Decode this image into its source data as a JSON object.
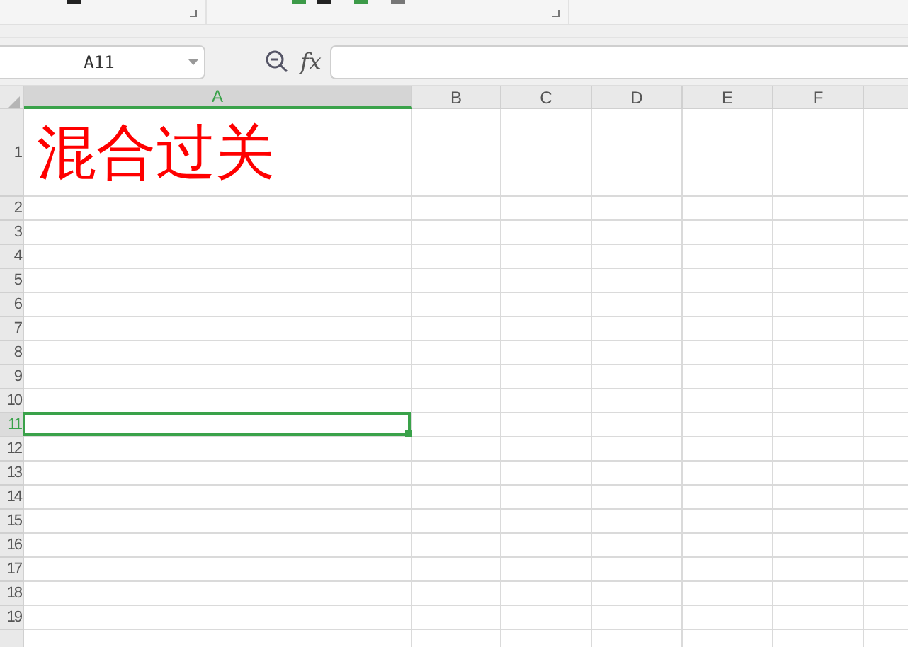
{
  "formula_bar": {
    "name_box": "A11",
    "fx_label": "fx"
  },
  "columns": [
    {
      "label": "A",
      "selected": true
    },
    {
      "label": "B",
      "selected": false
    },
    {
      "label": "C",
      "selected": false
    },
    {
      "label": "D",
      "selected": false
    },
    {
      "label": "E",
      "selected": false
    },
    {
      "label": "F",
      "selected": false
    }
  ],
  "rows": [
    {
      "label": "1",
      "selected": false,
      "cells": [
        {
          "text": "混合过关",
          "color": "#ff0000"
        }
      ]
    },
    {
      "label": "2",
      "selected": false
    },
    {
      "label": "3",
      "selected": false
    },
    {
      "label": "4",
      "selected": false
    },
    {
      "label": "5",
      "selected": false
    },
    {
      "label": "6",
      "selected": false
    },
    {
      "label": "7",
      "selected": false
    },
    {
      "label": "8",
      "selected": false
    },
    {
      "label": "9",
      "selected": false
    },
    {
      "label": "10",
      "selected": false
    },
    {
      "label": "11",
      "selected": true
    },
    {
      "label": "12",
      "selected": false
    },
    {
      "label": "13",
      "selected": false
    },
    {
      "label": "14",
      "selected": false
    },
    {
      "label": "15",
      "selected": false
    },
    {
      "label": "16",
      "selected": false
    },
    {
      "label": "17",
      "selected": false
    },
    {
      "label": "18",
      "selected": false
    },
    {
      "label": "19",
      "selected": false
    },
    {
      "selected": false
    }
  ]
}
